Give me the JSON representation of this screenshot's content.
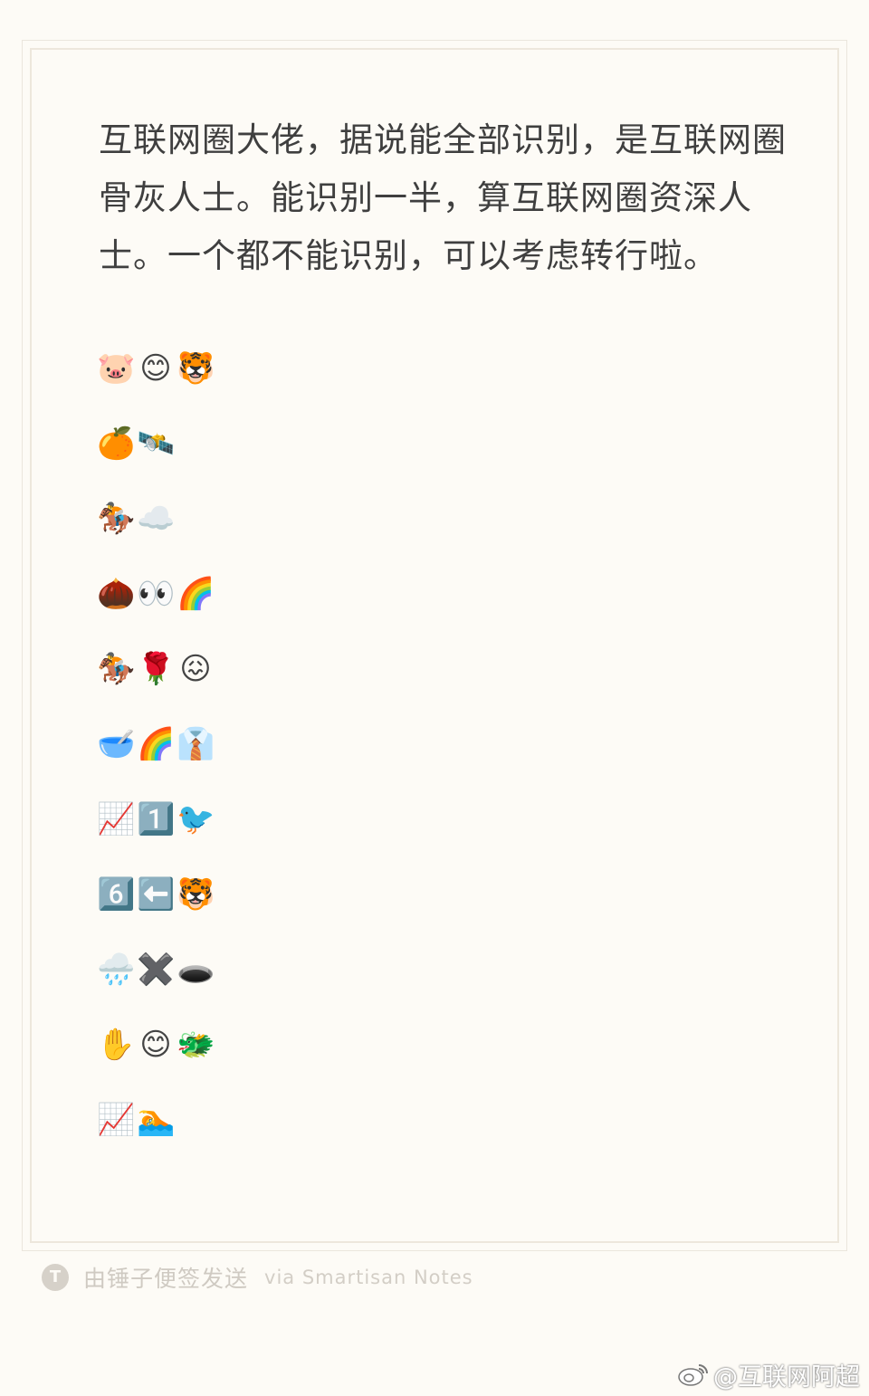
{
  "note": {
    "paragraph": "互联网圈大佬，据说能全部识别，是互联网圈骨灰人士。能识别一半，算互联网圈资深人士。一个都不能识别，可以考虑转行啦。",
    "emoji_rows": [
      [
        "🐷",
        "😊",
        "🐯"
      ],
      [
        "🍊",
        "🛰️"
      ],
      [
        "🏇",
        "☁️"
      ],
      [
        "🌰",
        "👀",
        "🌈"
      ],
      [
        "🏇",
        "🌹",
        "😖"
      ],
      [
        "🥣",
        "🌈",
        "👔"
      ],
      [
        "📈",
        "1️⃣",
        "🐦"
      ],
      [
        "6️⃣",
        "⬅️",
        "🐯"
      ],
      [
        "🌧️",
        "✖️",
        "🕳️"
      ],
      [
        "✋",
        "😊",
        "🐲"
      ],
      [
        "📈",
        "🏊"
      ]
    ]
  },
  "footer": {
    "logo_letter": "T",
    "sent_by": "由锤子便签发送",
    "via": "via Smartisan Notes"
  },
  "watermark": {
    "text": "@互联网阿超"
  }
}
